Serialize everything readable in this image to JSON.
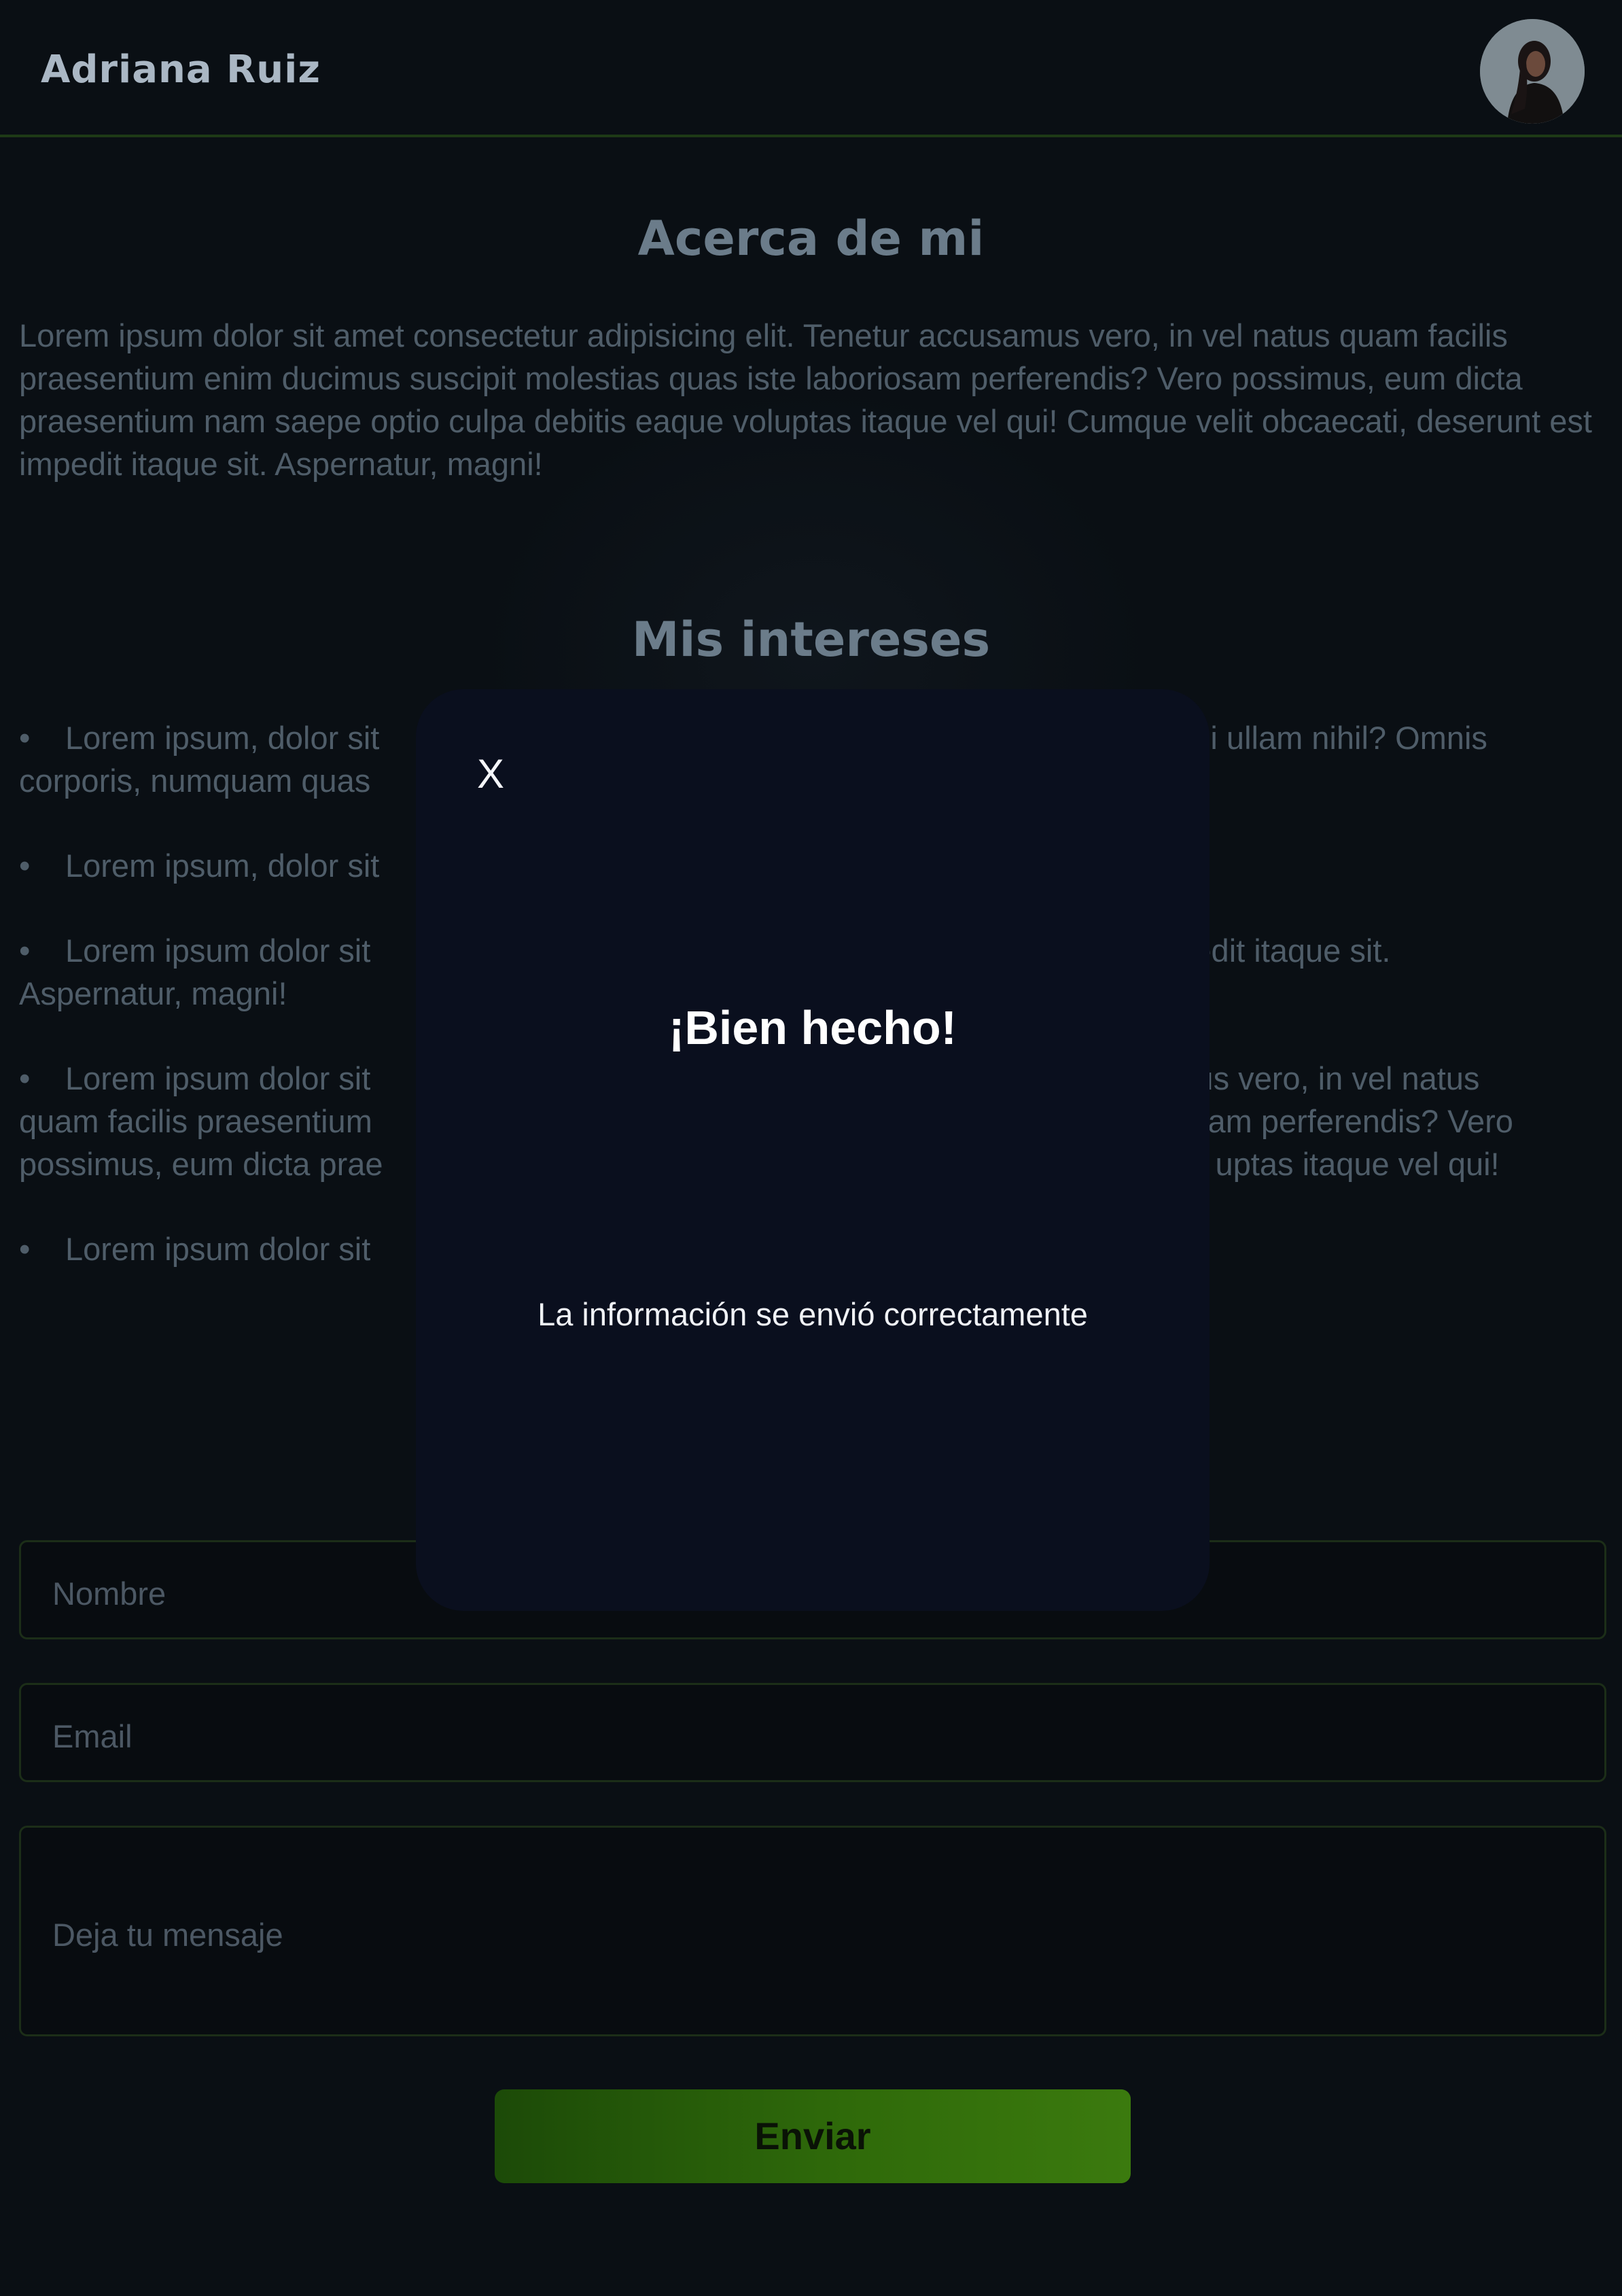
{
  "header": {
    "brand": "Adriana Ruiz",
    "avatar_icon": "profile-photo"
  },
  "about": {
    "title": "Acerca de mi",
    "text": "Lorem ipsum dolor sit amet consectetur adipisicing elit. Tenetur accusamus vero, in vel natus quam facilis praesentium enim ducimus suscipit molestias quas iste laboriosam perferendis? Vero possimus, eum dicta praesentium nam saepe optio culpa debitis eaque voluptas itaque vel qui! Cumque velit obcaecati, deserunt est impedit itaque sit. Aspernatur, magni!"
  },
  "interests": {
    "title": "Mis intereses",
    "bullet": "•",
    "items": [
      {
        "left": "Lorem ipsum, dolor sit",
        "right": "nisi ullam nihil? Omnis",
        "line2": "corporis, numquam quas"
      },
      {
        "left": "Lorem ipsum, dolor sit",
        "right": "",
        "line2": ""
      },
      {
        "left": "Lorem ipsum dolor sit",
        "right": "pedit itaque sit.",
        "line2": "Aspernatur, magni!"
      },
      {
        "left": "Lorem ipsum dolor sit",
        "right": "mus vero, in vel natus",
        "line2": "quam facilis praesentium",
        "line2_right": "osam perferendis? Vero",
        "line3": "possimus, eum dicta prae",
        "line3_right": "uptas itaque vel qui!"
      },
      {
        "left": "Lorem ipsum dolor sit",
        "right": "",
        "line2": ""
      }
    ]
  },
  "form": {
    "name_placeholder": "Nombre",
    "email_placeholder": "Email",
    "message_placeholder": "Deja tu mensaje",
    "submit_label": "Enviar"
  },
  "modal": {
    "close_label": "X",
    "title": "¡Bien hecho!",
    "message": "La información se envió correctamente"
  },
  "colors": {
    "background": "#0a0f14",
    "modal_background": "#0a0f1e",
    "accent_green": "#2f6a0a"
  }
}
